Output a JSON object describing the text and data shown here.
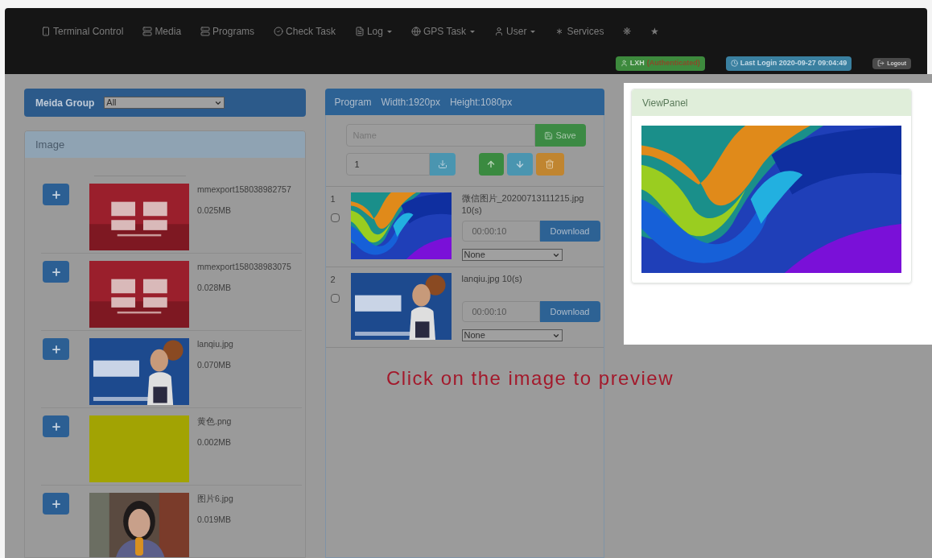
{
  "nav": {
    "items": [
      {
        "label": "Terminal Control",
        "kind": "link"
      },
      {
        "label": "Media",
        "kind": "link"
      },
      {
        "label": "Programs",
        "kind": "link"
      },
      {
        "label": "Check Task",
        "kind": "link"
      },
      {
        "label": "Log",
        "kind": "dropdown"
      },
      {
        "label": "GPS Task",
        "kind": "dropdown"
      },
      {
        "label": "User",
        "kind": "dropdown"
      },
      {
        "label": "Services",
        "kind": "link"
      },
      {
        "label": "❋",
        "kind": "link"
      },
      {
        "label": "★",
        "kind": "link"
      }
    ],
    "user": "LXH",
    "auth": "(Authenticated)",
    "last_login": "Last Login 2020-09-27 09:04:49",
    "logout": "Logout"
  },
  "media_group": {
    "label": "Meida Group",
    "value": "All"
  },
  "image_panel": {
    "title": "Image",
    "items": [
      {
        "name": "mmexport158038982757",
        "size": "0.025MB"
      },
      {
        "name": "mmexport158038983075",
        "size": "0.028MB"
      },
      {
        "name": "lanqiu.jpg",
        "size": "0.070MB"
      },
      {
        "name": "黄色.png",
        "size": "0.002MB"
      },
      {
        "name": "图片6.jpg",
        "size": "0.019MB"
      }
    ]
  },
  "program": {
    "title": "Program",
    "width": "Width:1920px",
    "height": "Height:1080px",
    "name_placeholder": "Name",
    "save": "Save",
    "index_value": "1",
    "items": [
      {
        "index": "1",
        "checked": false,
        "title": "微信图片_20200713111215.jpg",
        "duration": "10(s)",
        "time": "00:00:10",
        "download": "Download",
        "transition": "None"
      },
      {
        "index": "2",
        "checked": false,
        "title": "lanqiu.jpg",
        "duration": "10(s)",
        "time": "00:00:10",
        "download": "Download",
        "transition": "None"
      }
    ]
  },
  "view_panel": {
    "title": "ViewPanel"
  },
  "annotation": "Click on the image to preview"
}
